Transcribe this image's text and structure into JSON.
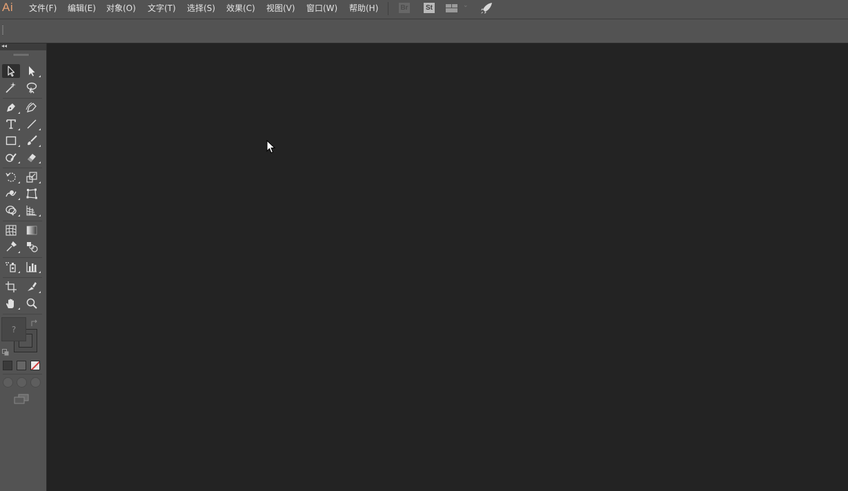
{
  "app": {
    "logo": "Ai"
  },
  "menubar": {
    "items": [
      {
        "label": "文件(F)"
      },
      {
        "label": "编辑(E)"
      },
      {
        "label": "对象(O)"
      },
      {
        "label": "文字(T)"
      },
      {
        "label": "选择(S)"
      },
      {
        "label": "效果(C)"
      },
      {
        "label": "视图(V)"
      },
      {
        "label": "窗口(W)"
      },
      {
        "label": "帮助(H)"
      }
    ],
    "bridge_label": "Br",
    "stock_label": "St",
    "workspace_icon": "workspace-layout-icon",
    "gpu_icon": "rocket-icon"
  },
  "tools": [
    "selection",
    "direct-selection",
    "magic-wand",
    "lasso",
    "pen",
    "curvature",
    "type",
    "line-segment",
    "rectangle",
    "paintbrush",
    "shaper",
    "eraser",
    "rotate",
    "scale",
    "warp",
    "free-transform",
    "shape-builder",
    "perspective-grid",
    "mesh",
    "gradient",
    "eyedropper",
    "blend",
    "symbol-sprayer",
    "column-graph",
    "artboard",
    "slice",
    "hand",
    "zoom"
  ],
  "color_area": {
    "fill_placeholder": "?"
  },
  "colors": {
    "menubar_bg": "#535353",
    "canvas_bg": "#232323",
    "logo": "#e6a173",
    "none_slash": "#d03a3a"
  }
}
